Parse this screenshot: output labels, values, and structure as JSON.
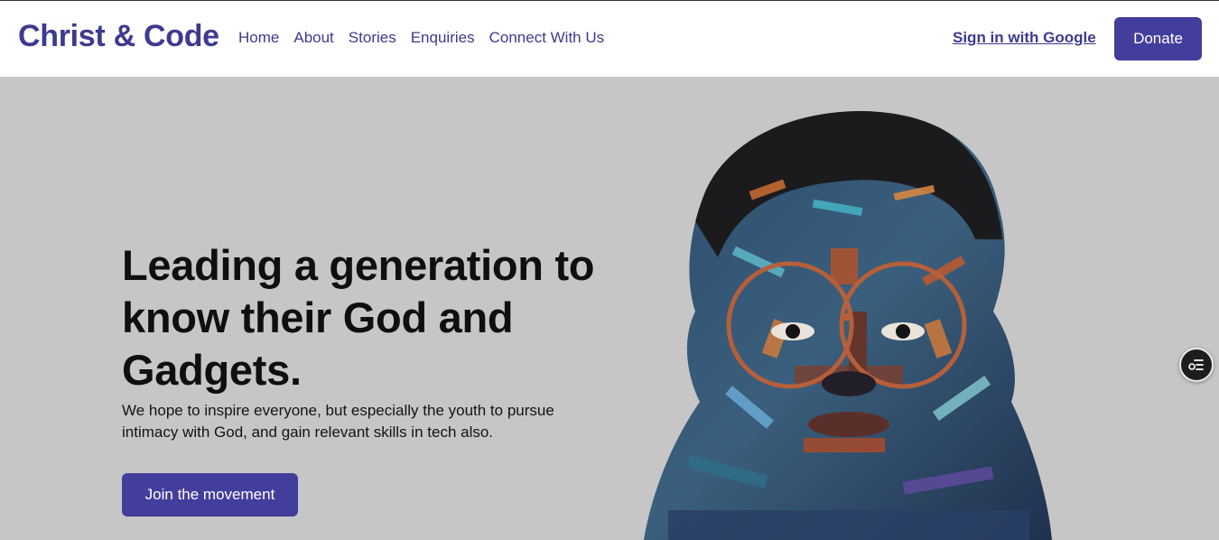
{
  "header": {
    "brand": "Christ & Code",
    "nav": [
      "Home",
      "About",
      "Stories",
      "Enquiries",
      "Connect With Us"
    ],
    "signin_label": "Sign in with Google",
    "donate_label": "Donate"
  },
  "hero": {
    "headline": "Leading a generation to know their God and Gadgets.",
    "subtext": "We hope to inspire everyone, but especially the youth to pursue intimacy with God, and gain relevant skills in tech also.",
    "cta_label": "Join the movement",
    "image": "painted-portrait-with-glasses"
  },
  "floating": {
    "icon": "list-settings-icon"
  },
  "colors": {
    "brand": "#3d3a91",
    "button": "#433e9c",
    "hero_bg": "#c6c6c6",
    "header_bg": "#ffffff"
  }
}
